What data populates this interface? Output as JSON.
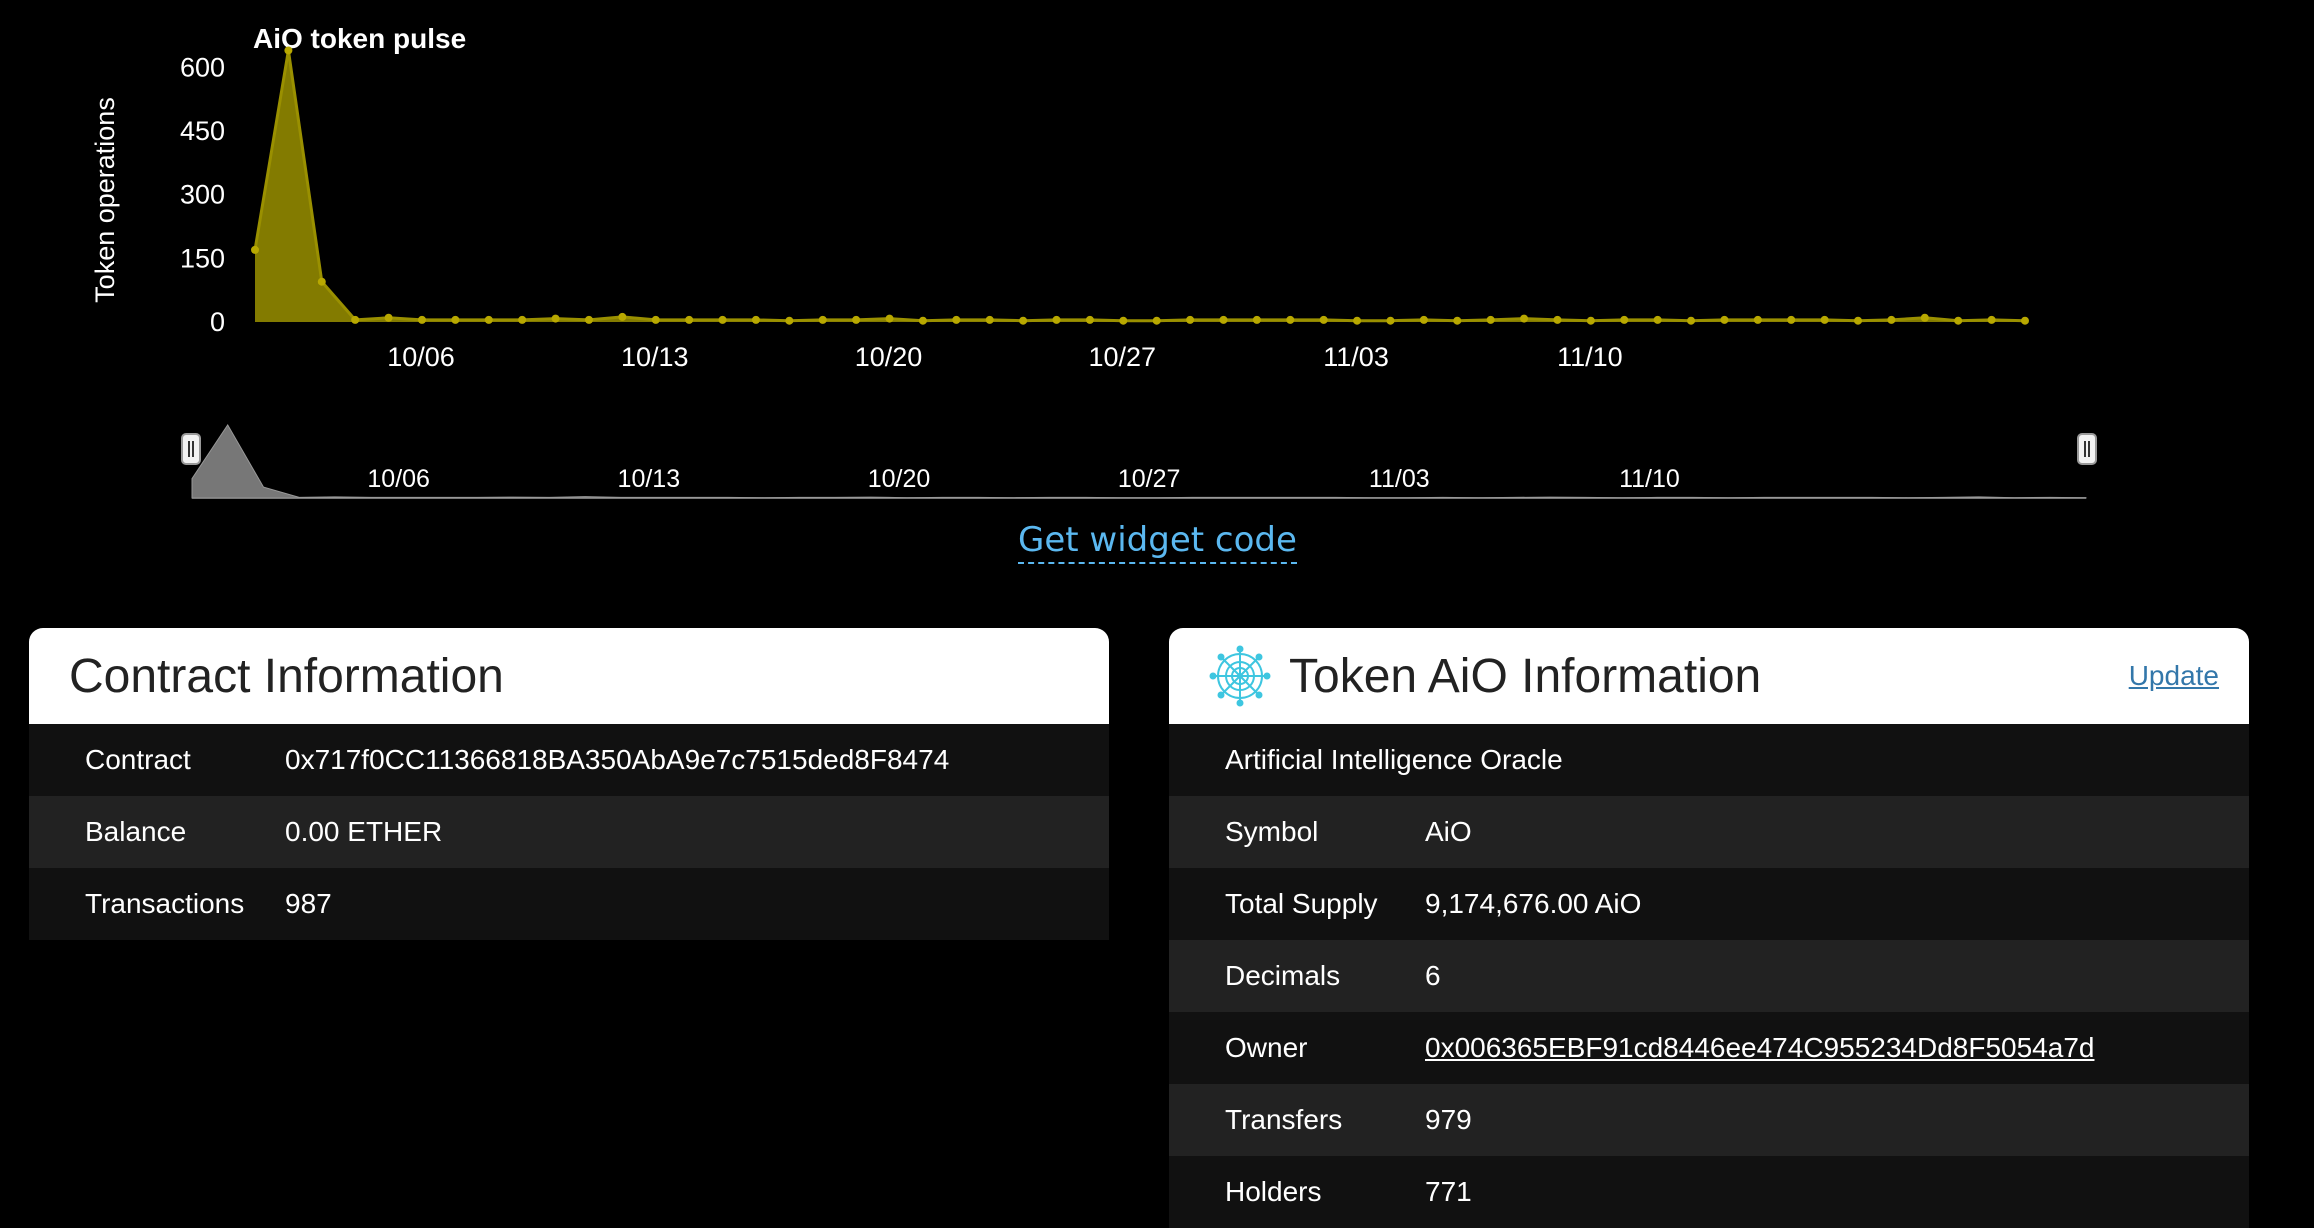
{
  "chart_data": {
    "type": "area",
    "title": "AiO token pulse",
    "ylabel": "Token operations",
    "ylim": [
      0,
      700
    ],
    "yticks": [
      "600",
      "450",
      "300",
      "150",
      "0"
    ],
    "ytick_values": [
      600,
      450,
      300,
      150,
      0
    ],
    "x_tick_labels": [
      "10/06",
      "10/13",
      "10/20",
      "10/27",
      "11/03",
      "11/10"
    ],
    "x_tick_index": [
      5,
      12,
      19,
      26,
      33,
      40
    ],
    "values": [
      170,
      640,
      95,
      5,
      10,
      5,
      5,
      5,
      5,
      8,
      5,
      12,
      5,
      5,
      5,
      5,
      3,
      5,
      5,
      8,
      3,
      5,
      5,
      3,
      5,
      5,
      3,
      3,
      5,
      5,
      5,
      5,
      5,
      3,
      3,
      5,
      3,
      5,
      8,
      5,
      3,
      5,
      5,
      3,
      5,
      5,
      5,
      5,
      3,
      5,
      10,
      3,
      5,
      3
    ],
    "color": "#9a9000",
    "navigator_color": "#777777",
    "navigator_tick_labels": [
      "10/06",
      "10/13",
      "10/20",
      "10/27",
      "11/03",
      "11/10"
    ]
  },
  "widget": {
    "label": "Get widget code"
  },
  "contract_card": {
    "title": "Contract Information",
    "rows": [
      {
        "key": "Contract",
        "value": "0x717f0CC11366818BA350AbA9e7c7515ded8F8474"
      },
      {
        "key": "Balance",
        "value": "0.00 ETHER"
      },
      {
        "key": "Transactions",
        "value": "987"
      }
    ]
  },
  "token_card": {
    "title": "Token AiO Information",
    "update_label": "Update",
    "logo_icon": "token-logo-icon",
    "name": "Artificial Intelligence Oracle",
    "rows": [
      {
        "key": "Symbol",
        "value": "AiO"
      },
      {
        "key": "Total Supply",
        "value": "9,174,676.00 AiO"
      },
      {
        "key": "Decimals",
        "value": "6"
      },
      {
        "key": "Owner",
        "value": "0x006365EBF91cd8446ee474C955234Dd8F5054a7d"
      },
      {
        "key": "Transfers",
        "value": "979"
      },
      {
        "key": "Holders",
        "value": "771"
      }
    ]
  }
}
